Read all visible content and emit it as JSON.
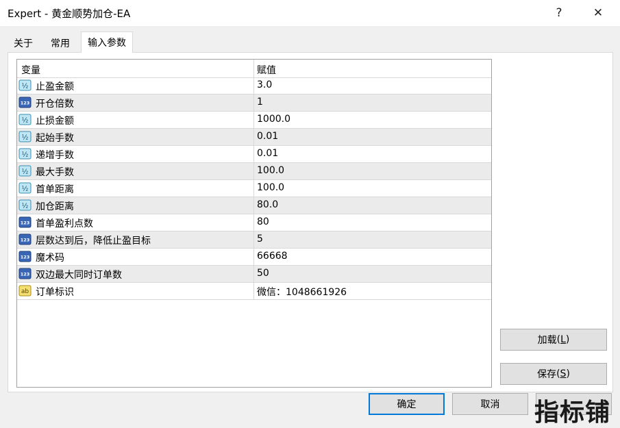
{
  "window": {
    "title": "Expert - 黄金顺势加仓-EA",
    "help": "?",
    "close": "✕"
  },
  "tabs": [
    {
      "label": "关于"
    },
    {
      "label": "常用"
    },
    {
      "label": "输入参数"
    }
  ],
  "table": {
    "headers": {
      "variable": "变量",
      "value": "赋值"
    },
    "rows": [
      {
        "icon": "double-type-icon",
        "badge": "½",
        "name": "止盈金额",
        "value": "3.0"
      },
      {
        "icon": "integer-type-icon",
        "badge": "123",
        "name": "开仓倍数",
        "value": "1"
      },
      {
        "icon": "double-type-icon",
        "badge": "½",
        "name": "止损金额",
        "value": "1000.0"
      },
      {
        "icon": "double-type-icon",
        "badge": "½",
        "name": "起始手数",
        "value": "0.01"
      },
      {
        "icon": "double-type-icon",
        "badge": "½",
        "name": "递增手数",
        "value": "0.01"
      },
      {
        "icon": "double-type-icon",
        "badge": "½",
        "name": "最大手数",
        "value": "100.0"
      },
      {
        "icon": "double-type-icon",
        "badge": "½",
        "name": "首单距离",
        "value": "100.0"
      },
      {
        "icon": "double-type-icon",
        "badge": "½",
        "name": "加仓距离",
        "value": "80.0"
      },
      {
        "icon": "integer-type-icon",
        "badge": "123",
        "name": "首单盈利点数",
        "value": "80"
      },
      {
        "icon": "integer-type-icon",
        "badge": "123",
        "name": "层数达到后，降低止盈目标",
        "value": "5"
      },
      {
        "icon": "integer-type-icon",
        "badge": "123",
        "name": "魔术码",
        "value": "66668"
      },
      {
        "icon": "integer-type-icon",
        "badge": "123",
        "name": "双边最大同时订单数",
        "value": "50"
      },
      {
        "icon": "string-type-icon",
        "badge": "ab",
        "name": "订单标识",
        "value": "微信：1048661926"
      }
    ]
  },
  "buttons": {
    "load": {
      "label": "加载",
      "key": "L"
    },
    "save": {
      "label": "保存",
      "key": "S"
    },
    "ok": "确定",
    "cancel": "取消"
  },
  "watermark": "指标铺"
}
